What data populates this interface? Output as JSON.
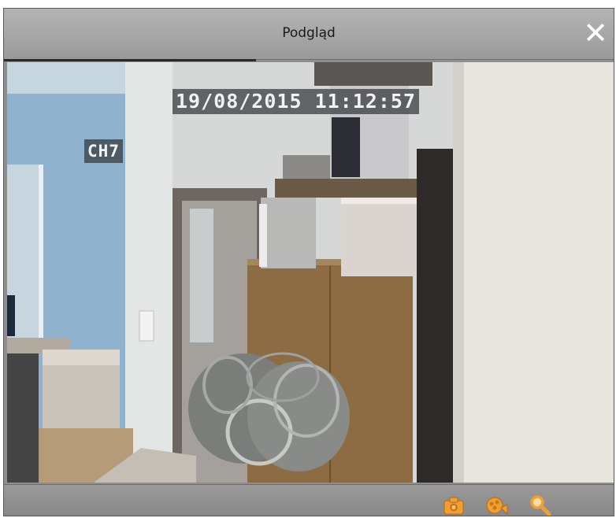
{
  "window": {
    "title": "Podgląd",
    "close_symbol": "✕"
  },
  "video": {
    "timestamp": "19/08/2015 11:12:57",
    "channel": "CH7"
  },
  "toolbar": {
    "buttons": [
      {
        "icon": "camera-icon",
        "action": "snapshot"
      },
      {
        "icon": "record-icon",
        "action": "record"
      },
      {
        "icon": "zoom-icon",
        "action": "zoom"
      }
    ],
    "icon_color": "#f0a030"
  }
}
